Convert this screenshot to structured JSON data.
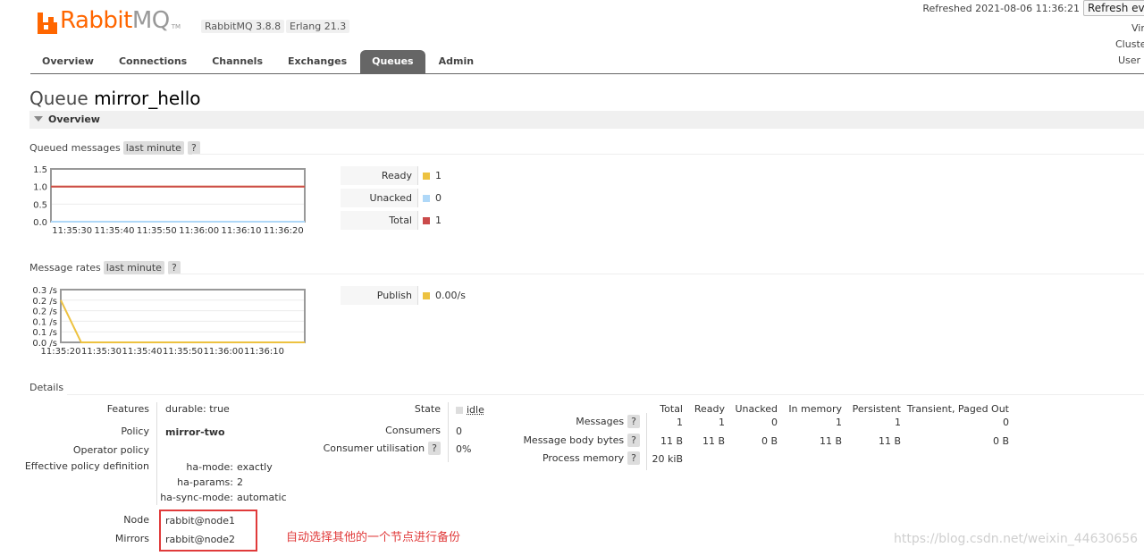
{
  "header": {
    "logo_rabbit": "Rabbit",
    "logo_mq": "MQ",
    "logo_tm": "TM",
    "rabbitmq_version": "RabbitMQ 3.8.8",
    "erlang_version": "Erlang 21.3",
    "refreshed": "Refreshed 2021-08-06 11:36:21",
    "refresh_button": "Refresh ever",
    "side_labels": [
      "Vir",
      "Cluste",
      "User a"
    ]
  },
  "tabs": [
    {
      "label": "Overview",
      "active": false
    },
    {
      "label": "Connections",
      "active": false
    },
    {
      "label": "Channels",
      "active": false
    },
    {
      "label": "Exchanges",
      "active": false
    },
    {
      "label": "Queues",
      "active": true
    },
    {
      "label": "Admin",
      "active": false
    }
  ],
  "page": {
    "title_prefix": "Queue",
    "queue_name": "mirror_hello",
    "section_title": "Overview"
  },
  "queued_messages": {
    "label": "Queued messages",
    "range": "last minute",
    "help": "?",
    "legend": [
      {
        "label": "Ready",
        "value": "1",
        "color": "#edc240"
      },
      {
        "label": "Unacked",
        "value": "0",
        "color": "#afd8f8"
      },
      {
        "label": "Total",
        "value": "1",
        "color": "#cb4b4b"
      }
    ]
  },
  "message_rates": {
    "label": "Message rates",
    "range": "last minute",
    "help": "?",
    "legend": [
      {
        "label": "Publish",
        "value": "0.00/s",
        "color": "#edc240"
      }
    ]
  },
  "chart_data": [
    {
      "type": "line",
      "x": [
        "11:35:25",
        "11:35:30",
        "11:35:40",
        "11:35:50",
        "11:36:00",
        "11:36:10",
        "11:36:20",
        "11:36:25"
      ],
      "xticks": [
        "11:35:30",
        "11:35:40",
        "11:35:50",
        "11:36:00",
        "11:36:10",
        "11:36:20"
      ],
      "yticks": [
        "0.0",
        "0.5",
        "1.0",
        "1.5"
      ],
      "ylim": [
        0,
        1.5
      ],
      "series": [
        {
          "name": "Ready",
          "color": "#edc240",
          "values": [
            1,
            1,
            1,
            1,
            1,
            1,
            1,
            1
          ]
        },
        {
          "name": "Unacked",
          "color": "#afd8f8",
          "values": [
            0,
            0,
            0,
            0,
            0,
            0,
            0,
            0
          ]
        },
        {
          "name": "Total",
          "color": "#cb4b4b",
          "values": [
            1,
            1,
            1,
            1,
            1,
            1,
            1,
            1
          ]
        }
      ]
    },
    {
      "type": "line",
      "x": [
        "11:35:20",
        "11:35:25",
        "11:35:30",
        "11:35:40",
        "11:35:50",
        "11:36:00",
        "11:36:10",
        "11:36:20"
      ],
      "xticks": [
        "11:35:20",
        "11:35:30",
        "11:35:40",
        "11:35:50",
        "11:36:00",
        "11:36:10"
      ],
      "yticks": [
        "0.0 /s",
        "0.1 /s",
        "0.1 /s",
        "0.2 /s",
        "0.2 /s",
        "0.3 /s"
      ],
      "ylim": [
        0,
        0.25
      ],
      "series": [
        {
          "name": "Publish",
          "color": "#edc240",
          "values": [
            0.2,
            0,
            0,
            0,
            0,
            0,
            0,
            0
          ]
        }
      ]
    }
  ],
  "details": {
    "label": "Details",
    "features_label": "Features",
    "durable_key": "durable:",
    "durable_value": "true",
    "policy_label": "Policy",
    "policy_value": "mirror-two",
    "operator_policy_label": "Operator policy",
    "effective_label": "Effective policy definition",
    "effective": [
      {
        "key": "ha-mode:",
        "value": "exactly"
      },
      {
        "key": "ha-params:",
        "value": "2"
      },
      {
        "key": "ha-sync-mode:",
        "value": "automatic"
      }
    ],
    "state_label": "State",
    "state_value": "idle",
    "state_color": "#dddddd",
    "consumers_label": "Consumers",
    "consumers_value": "0",
    "utilisation_label": "Consumer utilisation",
    "utilisation_help": "?",
    "utilisation_value": "0%",
    "node_label": "Node",
    "node_value": "rabbit@node1",
    "mirrors_label": "Mirrors",
    "mirrors_value": "rabbit@node2"
  },
  "messages_table": {
    "columns": [
      "Total",
      "Ready",
      "Unacked",
      "In memory",
      "Persistent",
      "Transient, Paged Out"
    ],
    "rows": [
      {
        "label": "Messages",
        "help": "?",
        "cells": [
          "1",
          "1",
          "0",
          "1",
          "1",
          "0"
        ]
      },
      {
        "label": "Message body bytes",
        "help": "?",
        "cells": [
          "11 B",
          "11 B",
          "0 B",
          "11 B",
          "11 B",
          "0 B"
        ]
      },
      {
        "label": "Process memory",
        "help": "?",
        "cells": [
          "20 kiB"
        ]
      }
    ]
  },
  "annotation": "自动选择其他的一个节点进行备份",
  "watermark": "https://blog.csdn.net/weixin_44630656"
}
